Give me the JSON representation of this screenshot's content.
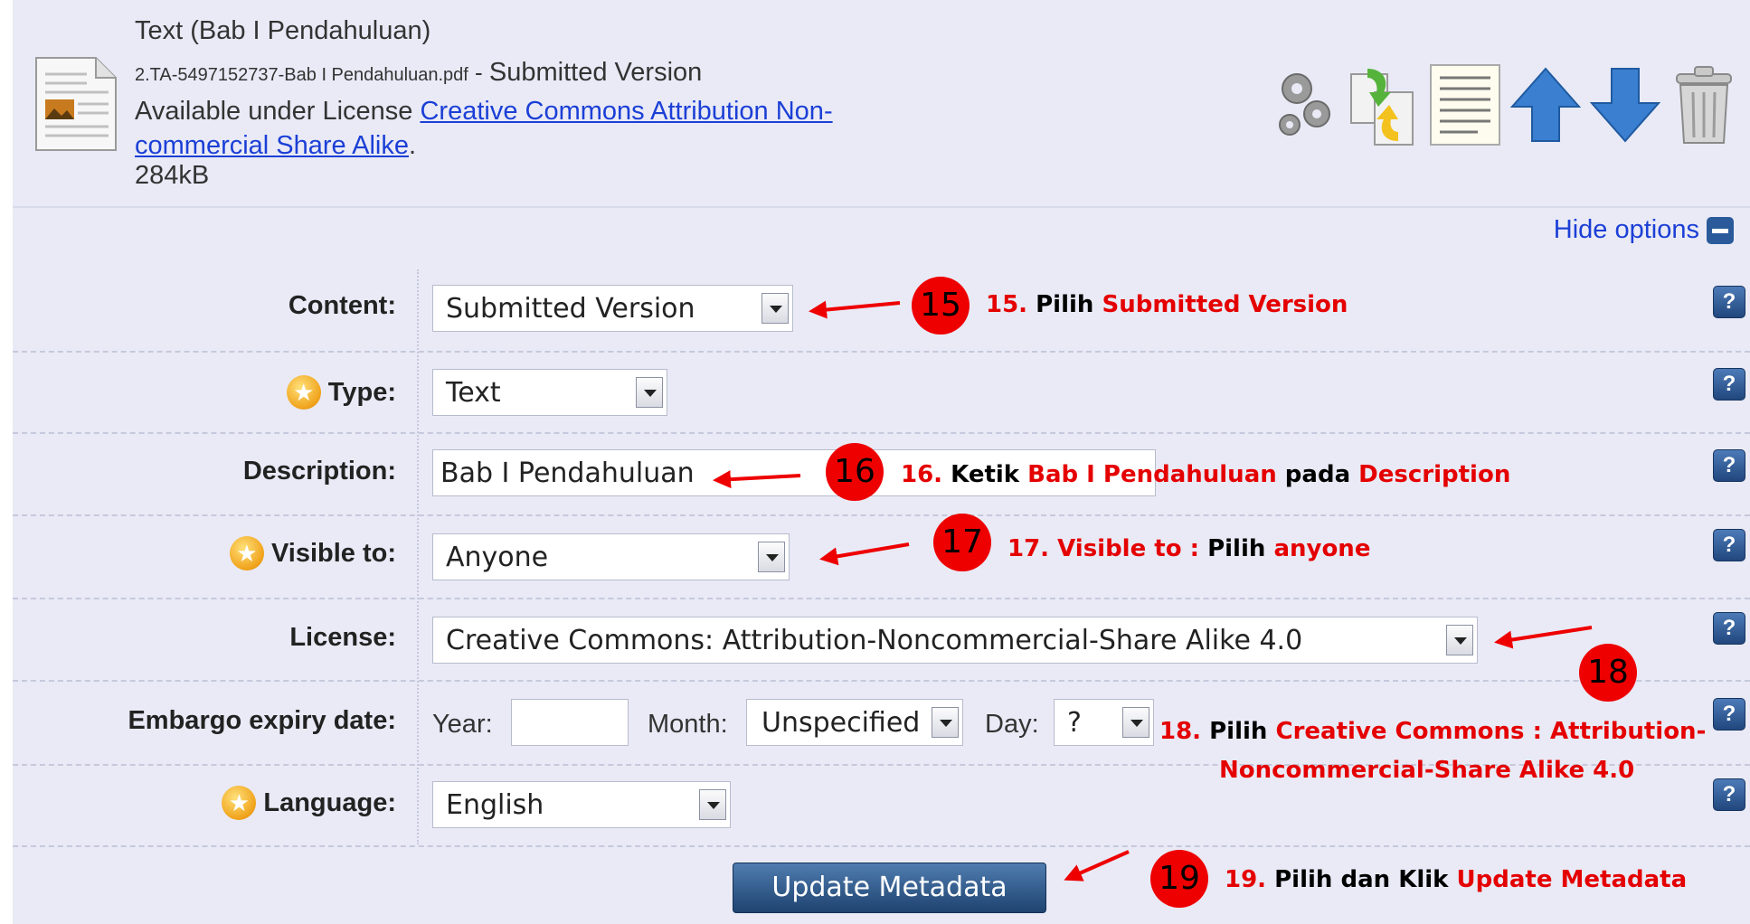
{
  "file": {
    "title": "Text (Bab I Pendahuluan)",
    "filename": "2.TA-5497152737-Bab I Pendahuluan.pdf",
    "separator": " - ",
    "version": "Submitted Version",
    "license_prefix": "Available under License ",
    "license_link_line1": "Creative Commons Attribution Non-",
    "license_link_line2": "commercial Share Alike",
    "license_suffix": ".",
    "size": "284kB"
  },
  "toolbar": {
    "icons": [
      "gears-icon",
      "replace-document-icon",
      "document-list-icon",
      "arrow-up-icon",
      "arrow-down-icon",
      "trash-icon"
    ]
  },
  "hide_options": "Hide options",
  "form": {
    "content": {
      "label": "Content:",
      "value": "Submitted Version"
    },
    "type": {
      "label": "Type:",
      "value": "Text"
    },
    "description": {
      "label": "Description:",
      "value": "Bab I Pendahuluan"
    },
    "visible_to": {
      "label": "Visible to:",
      "value": "Anyone"
    },
    "license": {
      "label": "License:",
      "value": "Creative Commons: Attribution-Noncommercial-Share Alike 4.0"
    },
    "embargo": {
      "label": "Embargo expiry date:",
      "year_label": "Year:",
      "year_value": "",
      "month_label": "Month:",
      "month_value": "Unspecified",
      "day_label": "Day:",
      "day_value": "?"
    },
    "language": {
      "label": "Language:",
      "value": "English"
    },
    "help_glyph": "?",
    "submit_label": "Update Metadata"
  },
  "annotations": {
    "a15": {
      "num": "15",
      "p1": "15. ",
      "p2": "Pilih ",
      "p3": "Submitted Version"
    },
    "a16": {
      "num": "16",
      "p1": "16. ",
      "p2": "Ketik ",
      "p3": "Bab I Pendahuluan",
      "p4": " pada ",
      "p5": "Description"
    },
    "a17": {
      "num": "17",
      "p1": "17. Visible to : ",
      "p2": "Pilih ",
      "p3": "anyone"
    },
    "a18": {
      "num": "18",
      "p1": "18. ",
      "p2": "Pilih ",
      "p3": "Creative Commons : Attribution-",
      "p4": "Noncommercial-Share Alike 4.0"
    },
    "a19": {
      "num": "19",
      "p1": "19. ",
      "p2": "Pilih dan Klik ",
      "p3": "Update Metadata"
    }
  },
  "colors": {
    "panel": "#e9eaf6",
    "link": "#1b3fd6",
    "annotation_red": "#e50000",
    "button": "#2a5a8f"
  }
}
